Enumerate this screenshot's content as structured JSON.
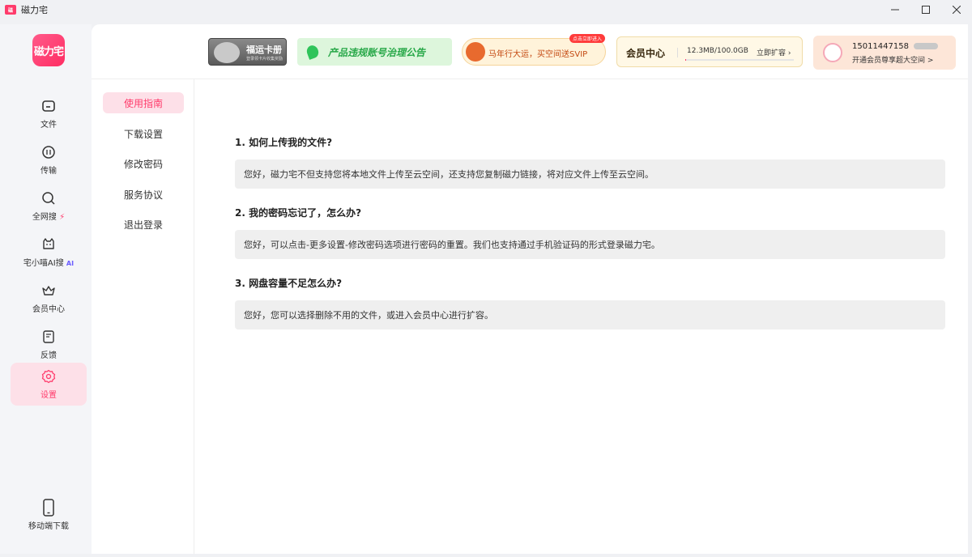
{
  "window": {
    "title": "磁力宅",
    "app_icon_text": "磁力宅",
    "controls": {
      "minimize": "–",
      "maximize": "☐",
      "close": "✕"
    }
  },
  "logo": {
    "text": "磁力宅"
  },
  "nav": [
    {
      "label": "文件",
      "icon": "folder-icon"
    },
    {
      "label": "传输",
      "icon": "transfer-icon"
    },
    {
      "label": "全网搜",
      "icon": "search-icon",
      "badge": "⚡"
    },
    {
      "label": "宅小喵AI搜",
      "icon": "cat-icon",
      "badge": "AI"
    },
    {
      "label": "会员中心",
      "icon": "crown-icon"
    },
    {
      "label": "反馈",
      "icon": "feedback-icon"
    },
    {
      "label": "设置",
      "icon": "gear-icon",
      "active": true
    },
    {
      "label": "移动端下载",
      "icon": "phone-icon"
    }
  ],
  "header": {
    "card_banner": {
      "title": "福运卡册",
      "subtitle": "登录领卡片收集奖励"
    },
    "notice_banner": {
      "text": "产品违规账号治理公告"
    },
    "svip_banner": {
      "text": "马年行大运，买空间送SVIP",
      "tag": "点击立即进入"
    },
    "vip_center": {
      "title": "会员中心",
      "usage": "12.3MB/100.0GB",
      "expand": "立即扩容 ›",
      "usage_fraction": 0.00012
    },
    "user": {
      "phone": "15011447158",
      "sub": "开通会员尊享超大空间 >"
    }
  },
  "settings_menu": [
    {
      "label": "使用指南",
      "active": true
    },
    {
      "label": "下载设置"
    },
    {
      "label": "修改密码"
    },
    {
      "label": "服务协议"
    },
    {
      "label": "退出登录"
    }
  ],
  "faq": [
    {
      "q": "1. 如何上传我的文件?",
      "a": "您好，磁力宅不但支持您将本地文件上传至云空间，还支持您复制磁力链接，将对应文件上传至云空间。"
    },
    {
      "q": "2. 我的密码忘记了，怎么办?",
      "a": "您好，可以点击-更多设置-修改密码选项进行密码的重置。我们也支持通过手机验证码的形式登录磁力宅。"
    },
    {
      "q": "3. 网盘容量不足怎么办?",
      "a": "您好，您可以选择删除不用的文件，或进入会员中心进行扩容。"
    }
  ],
  "colors": {
    "accent": "#ff3b6b",
    "active_bg": "#fde0e8",
    "notice_green": "#27a848"
  }
}
